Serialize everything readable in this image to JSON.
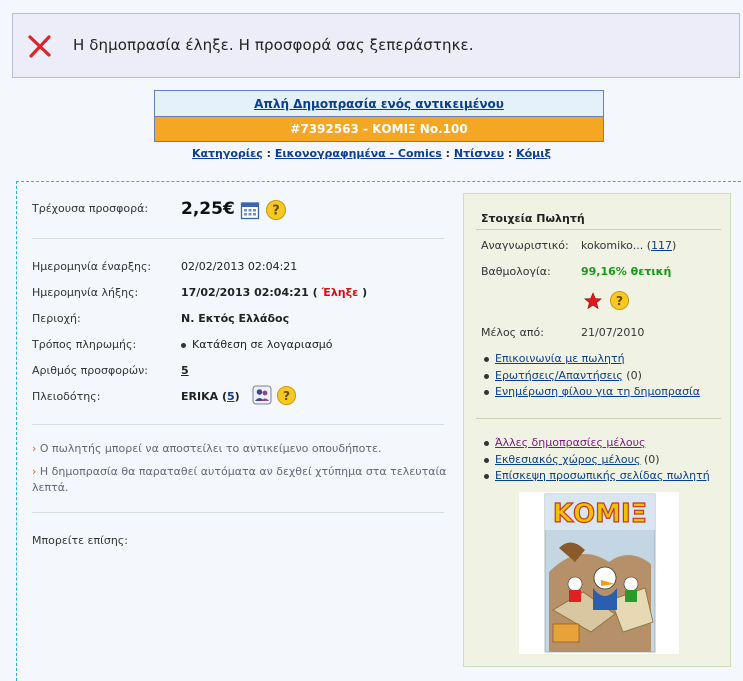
{
  "alert": {
    "message": "Η δημοπρασία έληξε. Η προσφορά σας ξεπεράστηκε."
  },
  "banner": {
    "type": "Απλή Δημοπρασία ενός αντικειμένου",
    "item": "#7392563 - ΚΟΜΙΞ Νο.100"
  },
  "breadcrumb": [
    "Κατηγορίες",
    "Εικονογραφημένα - Comics",
    "Ντίσνευ",
    "Κόμιξ"
  ],
  "auction": {
    "current_bid_label": "Τρέχουσα προσφορά:",
    "current_bid_value": "2,25€",
    "start_label": "Ημερομηνία έναρξης:",
    "start_value": "02/02/2013 02:04:21",
    "end_label": "Ημερομηνία λήξης:",
    "end_value": "17/02/2013 02:04:21",
    "end_status": "Έληξε",
    "region_label": "Περιοχή:",
    "region_value": "Ν. Εκτός Ελλάδος",
    "payment_label": "Τρόπος πληρωμής:",
    "payment_value": "Κατάθεση σε λογαριασμό",
    "bids_label": "Αριθμός προσφορών:",
    "bids_value": "5",
    "bidder_label": "Πλειοδότης:",
    "bidder_name": "ERIKA",
    "bidder_score": "5"
  },
  "notes": [
    "Ο πωλητής μπορεί να αποστείλει το αντικείμενο οπουδήποτε.",
    "Η δημοπρασία θα παραταθεί αυτόματα αν δεχθεί χτύπημα στα τελευταία λεπτά."
  ],
  "also_label": "Μπορείτε επίσης:",
  "seller": {
    "title": "Στοιχεία Πωλητή",
    "id_label": "Αναγνωριστικό:",
    "id_value": "kokomiko...",
    "id_score": "117",
    "rating_label": "Βαθμολογία:",
    "rating_value": "99,16% θετική",
    "member_label": "Μέλος από:",
    "member_value": "21/07/2010",
    "links_1": [
      "Επικοινωνία με πωλητή",
      "Ερωτήσεις/Απαντήσεις",
      "Ενημέρωση φίλου για τη δημοπρασία"
    ],
    "qa_count": "(0)",
    "links_2": [
      "Άλλες δημοπρασίες μέλους",
      "Εκθεσιακός χώρος μέλους",
      "Επίσκεψη προσωπικής σελίδας πωλητή"
    ],
    "showroom_count": "(0)",
    "cover_title": "ΚΟΜΙΞ"
  }
}
